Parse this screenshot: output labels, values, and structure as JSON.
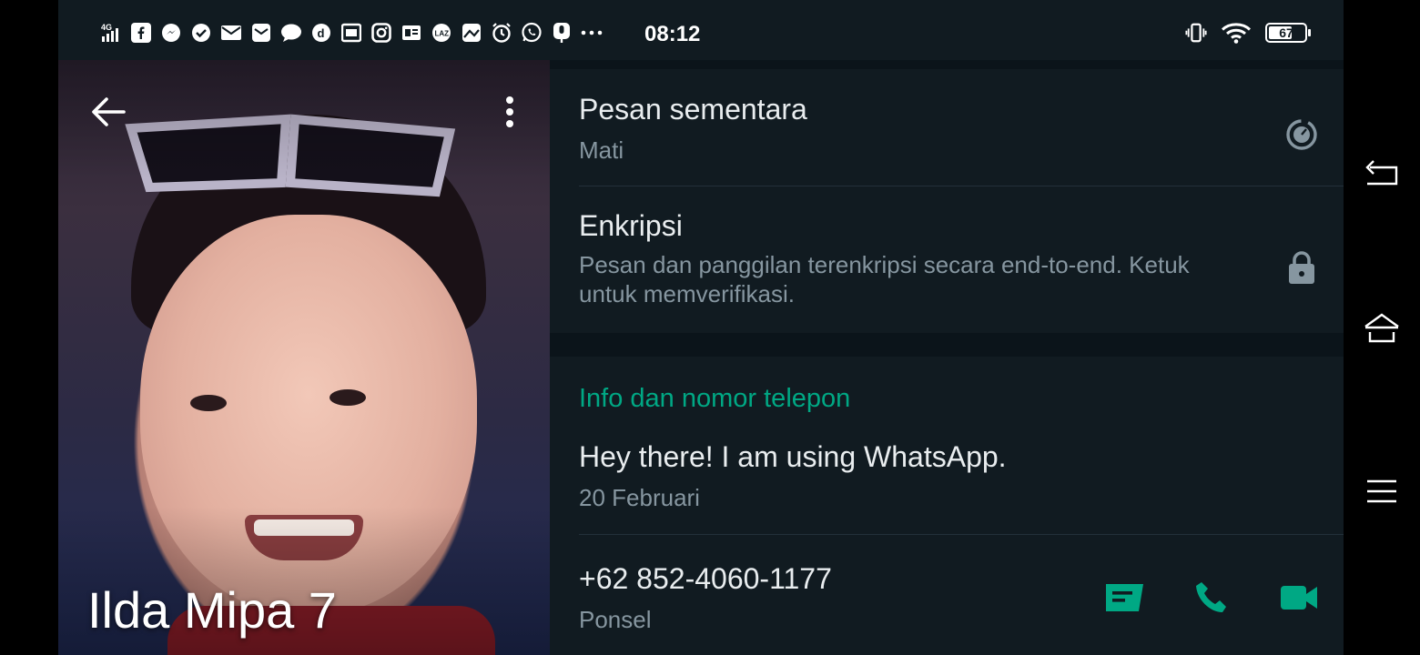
{
  "status_bar": {
    "network": "4G",
    "time": "08:12",
    "battery": "67",
    "battery_level": 0.67,
    "notification_icons": [
      "facebook-icon",
      "messenger-icon",
      "check-icon",
      "mail-icon",
      "mail-icon",
      "chat-icon",
      "dana-icon",
      "tab-icon",
      "instagram-icon",
      "news-icon",
      "lazada-icon",
      "map-icon",
      "alarm-icon",
      "whatsapp-icon",
      "microphone-icon",
      "more-dots-icon"
    ],
    "right_icons": [
      "vibrate-icon",
      "wifi-icon",
      "battery-icon"
    ]
  },
  "profile": {
    "name": "Ilda Mipa 7"
  },
  "disappearing": {
    "title": "Pesan sementara",
    "value": "Mati",
    "icon": "timer-icon"
  },
  "encryption": {
    "title": "Enkripsi",
    "description": "Pesan dan panggilan terenkripsi secara end-to-end. Ketuk untuk memverifikasi.",
    "icon": "lock-icon"
  },
  "about": {
    "section_title": "Info dan nomor telepon",
    "status_text": "Hey there! I am using WhatsApp.",
    "status_date": "20 Februari"
  },
  "phone": {
    "number": "+62 852-4060-1177",
    "type": "Ponsel",
    "actions": [
      "message-icon",
      "phone-icon",
      "video-call-icon"
    ]
  },
  "colors": {
    "accent": "#00a884",
    "panel": "#111b21",
    "background": "#0b141a",
    "secondary_text": "#8696a0"
  },
  "navigation": {
    "buttons": [
      "back-nav-icon",
      "home-nav-icon",
      "recents-nav-icon"
    ]
  }
}
